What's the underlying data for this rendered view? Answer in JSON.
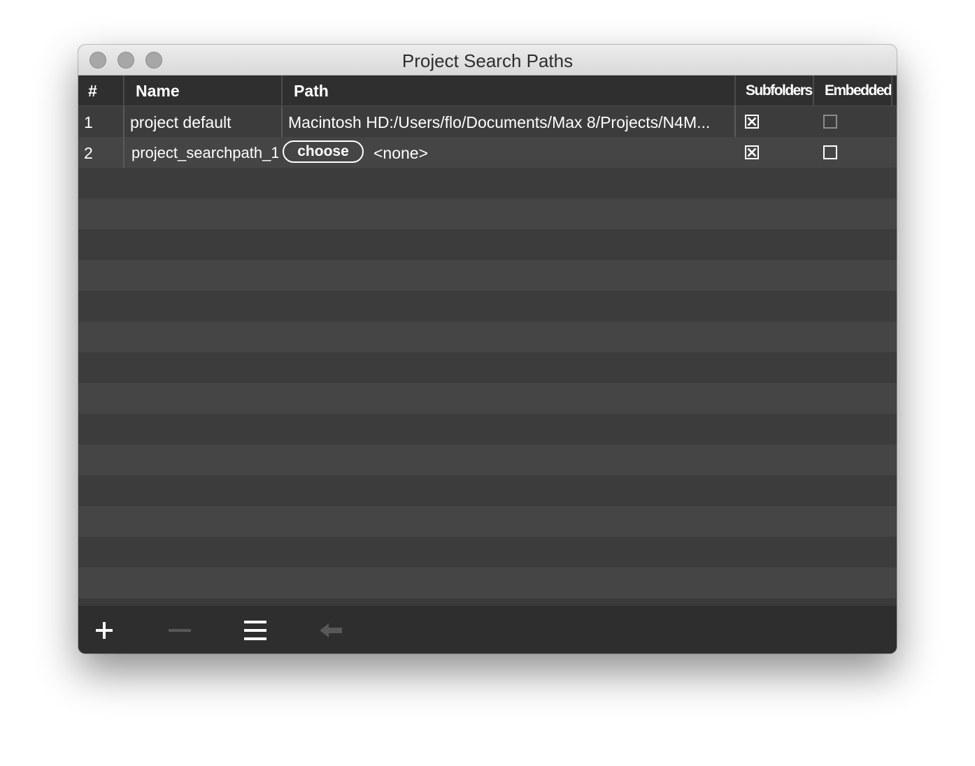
{
  "window": {
    "title": "Project Search Paths"
  },
  "table": {
    "columns": {
      "index": "#",
      "name": "Name",
      "path": "Path",
      "subfolders": "Subfolders",
      "embedded": "Embedded"
    },
    "rows": [
      {
        "index": "1",
        "name": "project default",
        "path": "Macintosh HD:/Users/flo/Documents/Max 8/Projects/N4M...",
        "subfolders": true,
        "embedded": false
      },
      {
        "index": "2",
        "name": "project_searchpath_1",
        "choose_label": "choose",
        "path": "<none>",
        "subfolders": true,
        "embedded": false
      }
    ]
  },
  "footer": {
    "icons": [
      "plus-icon",
      "minus-icon",
      "list-icon",
      "arrow-left-icon"
    ]
  },
  "colors": {
    "header_bg": "#2f2f2f",
    "row_odd": "#3c3c3c",
    "row_even": "#454545",
    "footer_bg": "#2e2e2e",
    "text": "#ffffff"
  }
}
